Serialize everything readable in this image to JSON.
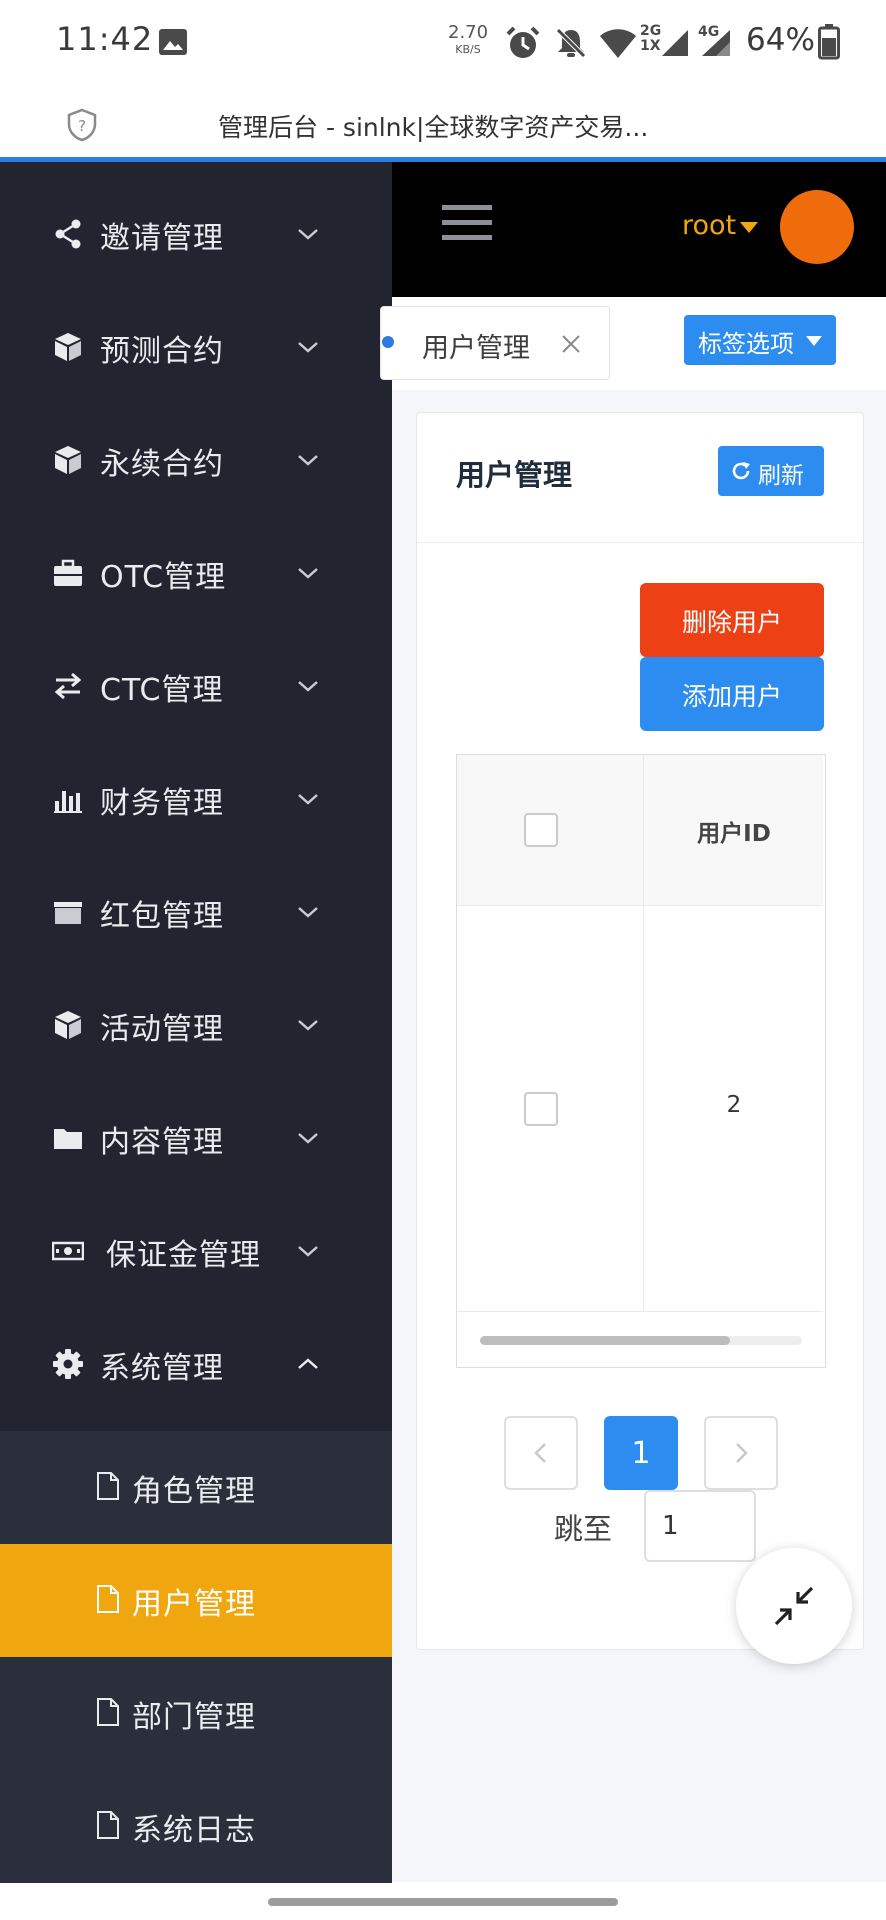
{
  "status_bar": {
    "time": "11:42",
    "net_speed_value": "2.70",
    "net_speed_unit": "KB/S",
    "signal_2g_label": "2G",
    "signal_1x_label": "1X",
    "signal_4g_label": "4G",
    "battery_percent": "64%",
    "icons": [
      "photo-icon",
      "alarm-icon",
      "mute-icon",
      "wifi-icon",
      "cell-signal-icon",
      "battery-icon"
    ]
  },
  "browser": {
    "page_title": "管理后台 - sinlnk|全球数字资产交易...",
    "accent_color": "#2d7ae0"
  },
  "sidebar": {
    "bg_color": "#22252f",
    "active_color": "#f0a60f",
    "items": [
      {
        "label": "邀请管理",
        "icon": "share-icon",
        "expanded": false
      },
      {
        "label": "预测合约",
        "icon": "cube-icon",
        "expanded": false
      },
      {
        "label": "永续合约",
        "icon": "cube-icon",
        "expanded": false
      },
      {
        "label": "OTC管理",
        "icon": "briefcase-icon",
        "expanded": false
      },
      {
        "label": "CTC管理",
        "icon": "exchange-icon",
        "expanded": false
      },
      {
        "label": "财务管理",
        "icon": "bar-chart-icon",
        "expanded": false
      },
      {
        "label": "红包管理",
        "icon": "envelope-box-icon",
        "expanded": false
      },
      {
        "label": "活动管理",
        "icon": "cube-icon",
        "expanded": false
      },
      {
        "label": "内容管理",
        "icon": "folder-icon",
        "expanded": false
      },
      {
        "label": "保证金管理",
        "icon": "money-icon",
        "expanded": false
      },
      {
        "label": "系统管理",
        "icon": "gear-icon",
        "expanded": true
      }
    ],
    "sub_items": [
      {
        "label": "角色管理",
        "active": false
      },
      {
        "label": "用户管理",
        "active": true
      },
      {
        "label": "部门管理",
        "active": false
      },
      {
        "label": "系统日志",
        "active": false
      }
    ]
  },
  "header": {
    "user_name": "root",
    "avatar_color": "#ef6c0d"
  },
  "tabs": {
    "open_tab_label": "用户管理",
    "options_label": "标签选项"
  },
  "panel": {
    "title": "用户管理",
    "refresh_label": "刷新",
    "delete_user_label": "删除用户",
    "add_user_label": "添加用户"
  },
  "table": {
    "columns": [
      "",
      "用户ID"
    ],
    "rows": [
      {
        "checked": false,
        "user_id": "2"
      }
    ]
  },
  "pagination": {
    "current_page": "1",
    "jump_label": "跳至",
    "jump_value": "1"
  },
  "colors": {
    "primary": "#2d8cf0",
    "danger": "#ed4014"
  }
}
